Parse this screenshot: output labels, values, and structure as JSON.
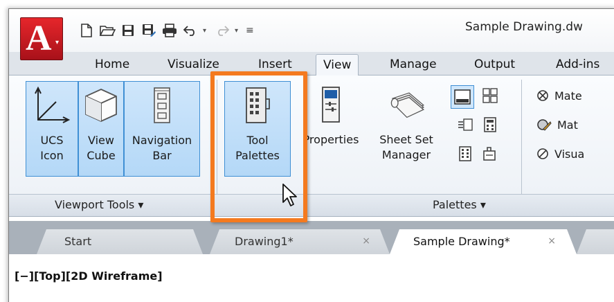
{
  "document_title": "Sample Drawing.dw",
  "app_button": {
    "letter": "A"
  },
  "ribbon_tabs": [
    {
      "label": "Home"
    },
    {
      "label": "Visualize"
    },
    {
      "label": "Insert"
    },
    {
      "label": "View"
    },
    {
      "label": "Manage"
    },
    {
      "label": "Output"
    },
    {
      "label": "Add-ins"
    }
  ],
  "viewport_tools": {
    "panel_label": "Viewport Tools ▾",
    "buttons": [
      {
        "line1": "UCS",
        "line2": "Icon"
      },
      {
        "line1": "View",
        "line2": "Cube"
      },
      {
        "line1": "Navigation",
        "line2": "Bar"
      }
    ]
  },
  "palettes": {
    "panel_label": "Palettes ▾",
    "tool_palettes": {
      "line1": "Tool",
      "line2": "Palettes"
    },
    "properties": {
      "line1": "Properties"
    },
    "sheet_set_manager": {
      "line1": "Sheet Set",
      "line2": "Manager"
    }
  },
  "materials": [
    {
      "label": "Mate"
    },
    {
      "label": "Mat"
    },
    {
      "label": "Visua"
    }
  ],
  "doc_tabs": [
    {
      "label": "Start"
    },
    {
      "label": "Drawing1*",
      "close": "×"
    },
    {
      "label": "Sample Drawing*",
      "close": "×"
    }
  ],
  "viewport_label": "[−][Top][2D Wireframe]",
  "colors": {
    "highlight": "#f47a1f",
    "app_red": "#d41f27",
    "selected_blue": "#b4d8f7"
  }
}
